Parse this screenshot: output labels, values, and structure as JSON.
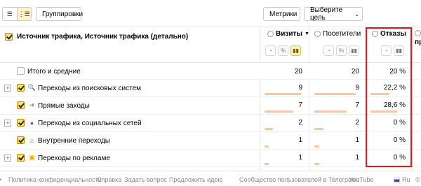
{
  "toolbar": {
    "view_list_icon": "list-icon",
    "view_tree_icon": "tree-icon",
    "groupings_label": "Группировки",
    "metrics_label": "Метрики",
    "goal_label": "Выберите цель",
    "goal_chevron": "⌄"
  },
  "header": {
    "dimension_title": "Источник трафика, Источник трафика (детально)",
    "metrics": [
      {
        "label": "Визиты",
        "sort": "▼"
      },
      {
        "label": "Посетители"
      },
      {
        "label": "Отказы"
      },
      {
        "label": "пр"
      }
    ],
    "icons": {
      "pie": "◔",
      "percent": "%",
      "bars": "▮▮",
      "pct_short": "%"
    }
  },
  "totals": {
    "label": "Итого и средние",
    "visits": "20",
    "visitors": "20",
    "bounce": "20 %"
  },
  "rows": [
    {
      "label": "Переходы из поисковых систем",
      "icon": "search-icon",
      "visits": "9",
      "visitors": "9",
      "bounce": "22,2 %",
      "visits_frac": 0.45,
      "bounce_frac": 0.5,
      "expandable": true
    },
    {
      "label": "Прямые заходы",
      "icon": "direct-icon",
      "visits": "7",
      "visitors": "7",
      "bounce": "28,6 %",
      "visits_frac": 0.35,
      "bounce_frac": 0.7,
      "expandable": false
    },
    {
      "label": "Переходы из социальных сетей",
      "icon": "social-icon",
      "visits": "2",
      "visitors": "2",
      "bounce": "0 %",
      "visits_frac": 0.1,
      "bounce_frac": 0.0,
      "expandable": true
    },
    {
      "label": "Внутренние переходы",
      "icon": "internal-icon",
      "visits": "1",
      "visitors": "1",
      "bounce": "0 %",
      "visits_frac": 0.05,
      "bounce_frac": 0.0,
      "expandable": false
    },
    {
      "label": "Переходы по рекламе",
      "icon": "ad-icon",
      "visits": "1",
      "visitors": "1",
      "bounce": "0 %",
      "visits_frac": 0.05,
      "bounce_frac": 0.0,
      "expandable": true
    }
  ],
  "footer": {
    "dot": "•",
    "privacy": "Политика конфиденциальности",
    "help": "Справка",
    "ask": "Задать вопрос",
    "idea": "Предложить идею",
    "community": "Сообщество пользователей в Телеграме",
    "youtube": "YouTube",
    "lang": "Ru",
    "copy": "©"
  },
  "colors": {
    "accent": "#ffe27a",
    "highlight": "#e0161a",
    "bar": "#f7c7a3"
  }
}
